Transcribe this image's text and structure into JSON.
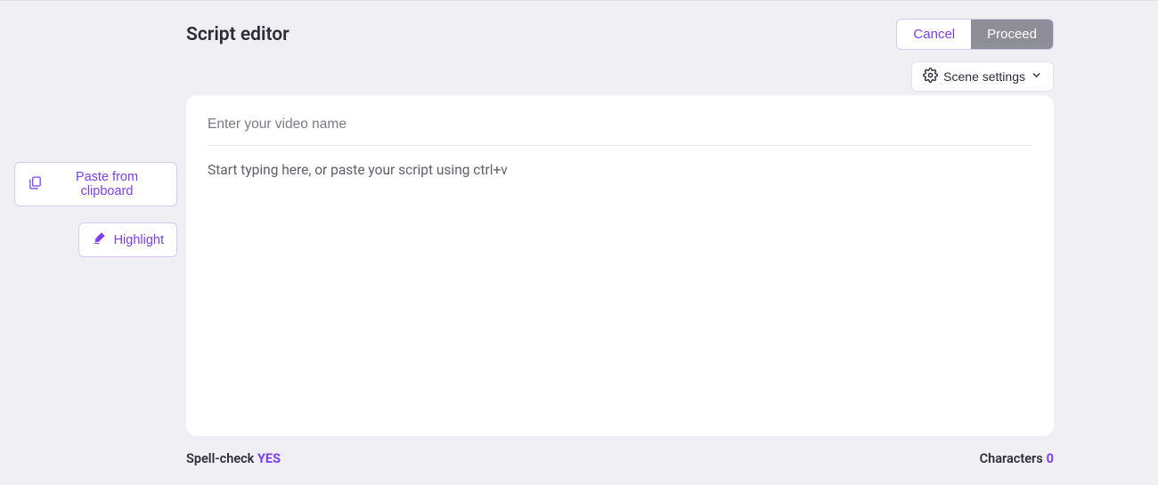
{
  "header": {
    "title": "Script editor",
    "cancel_label": "Cancel",
    "proceed_label": "Proceed"
  },
  "scene_settings": {
    "label": "Scene settings"
  },
  "side": {
    "paste_label": "Paste from clipboard",
    "highlight_label": "Highlight"
  },
  "editor": {
    "video_name_value": "",
    "video_name_placeholder": "Enter your video name",
    "script_value": "",
    "script_placeholder": "Start typing here, or paste your script using ctrl+v"
  },
  "footer": {
    "spellcheck_label": "Spell-check ",
    "spellcheck_value": "YES",
    "characters_label": "Characters",
    "characters_value": "0"
  },
  "colors": {
    "accent": "#7b3ff2",
    "proceed_bg": "#8e8e99",
    "page_bg": "#f0eff4"
  }
}
